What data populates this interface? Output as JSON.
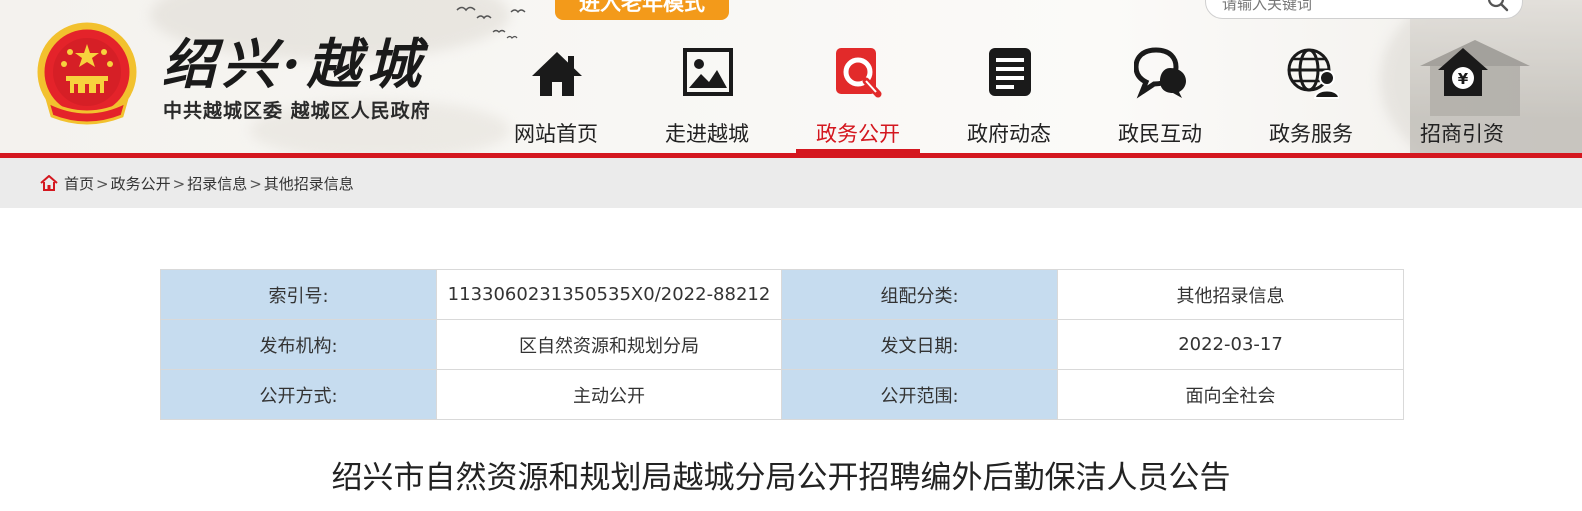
{
  "header": {
    "brand_title": "绍兴·越城",
    "brand_subtitle": "中共越城区委 越城区人民政府",
    "senior_mode_label": "进入老年模式",
    "search": {
      "placeholder": "请输入关键词"
    }
  },
  "nav": {
    "items": [
      {
        "label": "网站首页",
        "icon": "home-icon"
      },
      {
        "label": "走进越城",
        "icon": "image-icon"
      },
      {
        "label": "政务公开",
        "icon": "document-search-icon",
        "active": true
      },
      {
        "label": "政府动态",
        "icon": "news-icon"
      },
      {
        "label": "政民互动",
        "icon": "chat-icon"
      },
      {
        "label": "政务服务",
        "icon": "globe-user-icon"
      },
      {
        "label": "招商引资",
        "icon": "yuan-house-icon"
      }
    ],
    "active_color": "#d4171f"
  },
  "breadcrumb": {
    "items": [
      "首页",
      "政务公开",
      "招录信息",
      "其他招录信息"
    ],
    "separator": ">"
  },
  "info_table": {
    "rows": [
      {
        "k1": "索引号:",
        "v1": "1133060231350535X0/2022-88212",
        "k2": "组配分类:",
        "v2": "其他招录信息"
      },
      {
        "k1": "发布机构:",
        "v1": "区自然资源和规划分局",
        "k2": "发文日期:",
        "v2": "2022-03-17"
      },
      {
        "k1": "公开方式:",
        "v1": "主动公开",
        "k2": "公开范围:",
        "v2": "面向全社会"
      }
    ],
    "key_bg_color": "#c6dcef"
  },
  "article": {
    "title": "绍兴市自然资源和规划局越城分局公开招聘编外后勤保洁人员公告"
  }
}
